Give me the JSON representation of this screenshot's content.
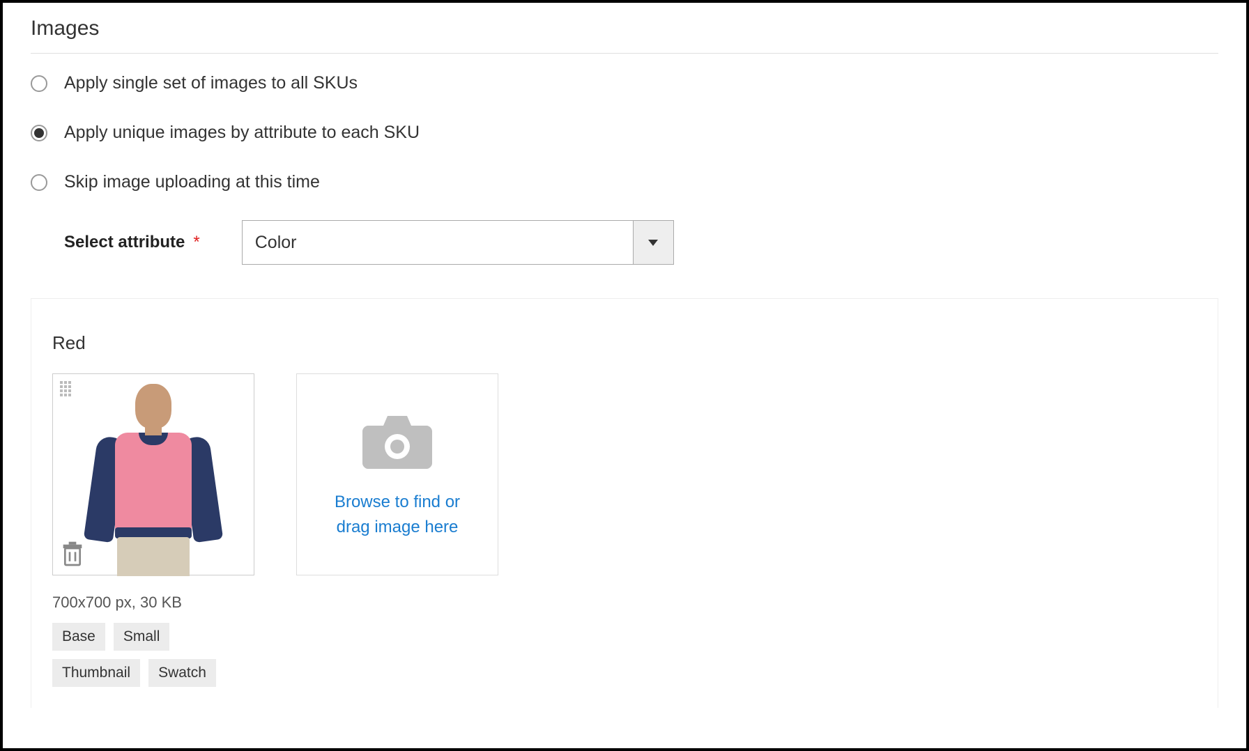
{
  "section_title": "Images",
  "radio_options": {
    "single": "Apply single set of images to all SKUs",
    "unique": "Apply unique images by attribute to each SKU",
    "skip": "Skip image uploading at this time"
  },
  "selected_option": "unique",
  "attribute": {
    "label": "Select attribute",
    "required_mark": "*",
    "selected": "Color"
  },
  "variant": {
    "name": "Red",
    "image_meta": "700x700 px, 30 KB",
    "roles": [
      "Base",
      "Small",
      "Thumbnail",
      "Swatch"
    ]
  },
  "upload": {
    "prompt_line1": "Browse to find or",
    "prompt_line2": "drag image here"
  }
}
